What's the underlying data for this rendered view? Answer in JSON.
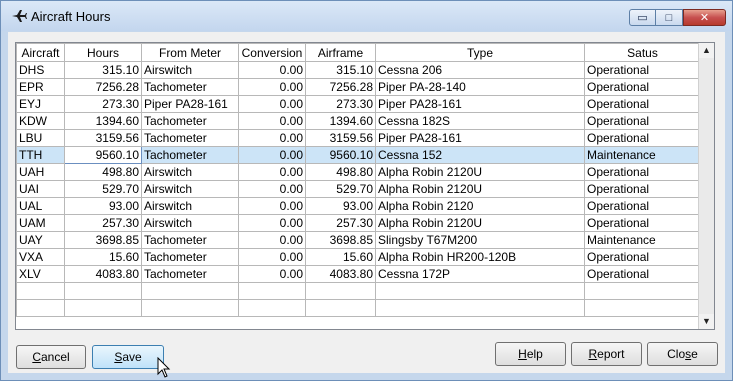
{
  "window": {
    "title": "Aircraft Hours"
  },
  "title_controls": {
    "minimize": "▭",
    "maximize": "□",
    "close": "✕"
  },
  "columns": [
    "Aircraft",
    "Hours",
    "From Meter",
    "Conversion",
    "Airframe",
    "Type",
    "Satus"
  ],
  "rows": [
    [
      "DHS",
      "315.10",
      "Airswitch",
      "0.00",
      "315.10",
      "Cessna 206",
      "Operational"
    ],
    [
      "EPR",
      "7256.28",
      "Tachometer",
      "0.00",
      "7256.28",
      "Piper PA-28-140",
      "Operational"
    ],
    [
      "EYJ",
      "273.30",
      "Piper PA28-161",
      "0.00",
      "273.30",
      "Piper PA28-161",
      "Operational"
    ],
    [
      "KDW",
      "1394.60",
      "Tachometer",
      "0.00",
      "1394.60",
      "Cessna 182S",
      "Operational"
    ],
    [
      "LBU",
      "3159.56",
      "Tachometer",
      "0.00",
      "3159.56",
      "Piper PA28-161",
      "Operational"
    ],
    [
      "TTH",
      "9560.10",
      "Tachometer",
      "0.00",
      "9560.10",
      "Cessna 152",
      "Maintenance"
    ],
    [
      "UAH",
      "498.80",
      "Airswitch",
      "0.00",
      "498.80",
      "Alpha Robin 2120U",
      "Operational"
    ],
    [
      "UAI",
      "529.70",
      "Airswitch",
      "0.00",
      "529.70",
      "Alpha Robin 2120U",
      "Operational"
    ],
    [
      "UAL",
      "93.00",
      "Airswitch",
      "0.00",
      "93.00",
      "Alpha Robin 2120",
      "Operational"
    ],
    [
      "UAM",
      "257.30",
      "Airswitch",
      "0.00",
      "257.30",
      "Alpha Robin 2120U",
      "Operational"
    ],
    [
      "UAY",
      "3698.85",
      "Tachometer",
      "0.00",
      "3698.85",
      "Slingsby T67M200",
      "Maintenance"
    ],
    [
      "VXA",
      "15.60",
      "Tachometer",
      "0.00",
      "15.60",
      "Alpha Robin HR200-120B",
      "Operational"
    ],
    [
      "XLV",
      "4083.80",
      "Tachometer",
      "0.00",
      "4083.80",
      "Cessna 172P",
      "Operational"
    ]
  ],
  "selected_row_index": 5,
  "buttons": {
    "cancel": {
      "first": "C",
      "rest": "ancel"
    },
    "save": {
      "first": "S",
      "rest": "ave"
    },
    "help": {
      "first": "H",
      "rest": "elp"
    },
    "report": {
      "first": "R",
      "rest": "eport"
    },
    "close": {
      "first": "Clo",
      "underlined": "s",
      "rest": "e"
    }
  },
  "scrollbar": {
    "up": "▲",
    "down": "▼"
  },
  "colors": {
    "selected_row": "#cce4f7",
    "title_bar": "#c5d7ec",
    "close_button": "#c75050"
  }
}
